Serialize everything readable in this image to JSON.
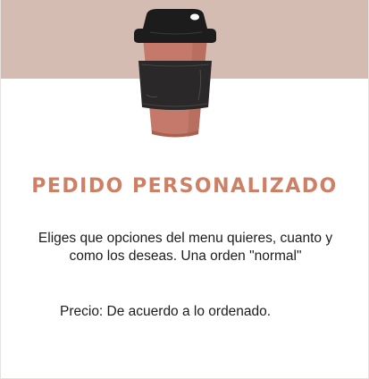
{
  "colors": {
    "band": "#d4bcb3",
    "accent": "#cf7f64",
    "cup_body": "#c4796a",
    "cup_lid": "#1c1c1c",
    "cup_sleeve": "#2a2828"
  },
  "card": {
    "image_icon": "coffee-cup-icon",
    "title": "PEDIDO PERSONALIZADO",
    "description": "Eliges que opciones del menu quieres, cuanto y como los deseas. Una orden \"normal\"",
    "price": "Precio: De acuerdo a lo ordenado."
  }
}
